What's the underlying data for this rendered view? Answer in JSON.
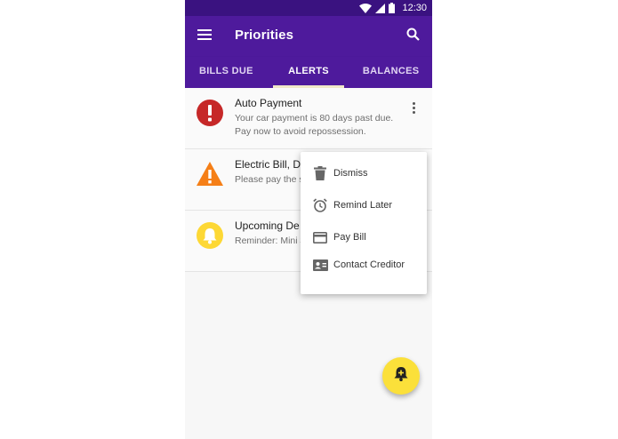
{
  "status_bar": {
    "time": "12:30"
  },
  "app_bar": {
    "title": "Priorities"
  },
  "tabs": [
    {
      "label": "BILLS DUE",
      "active": false
    },
    {
      "label": "ALERTS",
      "active": true
    },
    {
      "label": "BALANCES",
      "active": false
    }
  ],
  "alerts": [
    {
      "icon": "error-icon",
      "color": "#c62828",
      "title": "Auto Payment",
      "body": "Your car payment is 80 days past due. Pay now to avoid repossession."
    },
    {
      "icon": "warning-icon",
      "color": "#f57f17",
      "title": "Electric Bill, D",
      "body": "Please pay the service interrup"
    },
    {
      "icon": "bell-icon",
      "color": "#fdd835",
      "title": "Upcoming De",
      "body": "Reminder: Mini $100.00, is due"
    }
  ],
  "context_menu": {
    "items": [
      {
        "icon": "trash-icon",
        "label": "Dismiss"
      },
      {
        "icon": "alarm-icon",
        "label": "Remind Later"
      },
      {
        "icon": "credit-card-icon",
        "label": "Pay Bill"
      },
      {
        "icon": "contact-card-icon",
        "label": "Contact Creditor"
      }
    ]
  },
  "fab": {
    "icon": "add-alert-icon",
    "color": "#fbe03a"
  },
  "colors": {
    "app_bar": "#4e1a9c",
    "status_bar": "#3a1280"
  }
}
